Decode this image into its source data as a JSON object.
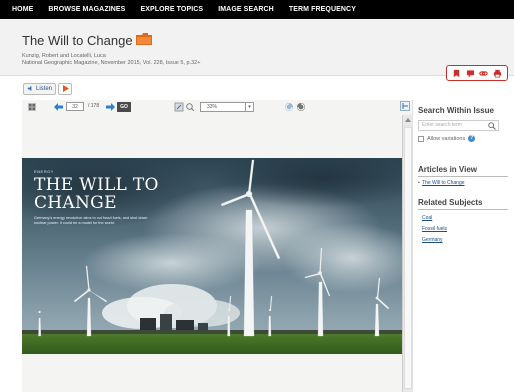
{
  "nav": {
    "items": [
      "HOME",
      "BROWSE MAGAZINES",
      "EXPLORE TOPICS",
      "IMAGE SEARCH",
      "TERM FREQUENCY"
    ]
  },
  "header": {
    "title": "The Will to Change",
    "authors": "Kunzig, Robert and Locatelli, Luca",
    "citation": "National Geographic Magazine, November 2015, Vol. 228, Issue 5, p.32+",
    "tool_icons": [
      "bookmark-icon",
      "comment-icon",
      "link-icon",
      "print-icon"
    ],
    "accent_color": "#c9302c"
  },
  "listen": {
    "label": "Listen"
  },
  "viewer": {
    "page_number": "32",
    "page_total": "/ 178",
    "go_label": "GO",
    "zoom": "33%",
    "article": {
      "kicker": "ENERGY",
      "title": "THE WILL TO CHANGE",
      "deck": "Germany's energy revolution aims to cut fossil fuels, and shut down nuclear power. It could be a model for the world."
    }
  },
  "sidebar": {
    "search_heading": "Search Within Issue",
    "search_placeholder": "Enter search term",
    "variations_label": "Allow variations",
    "help_label": "?",
    "articles_heading": "Articles in View",
    "articles": [
      "The Will to Change"
    ],
    "subjects_heading": "Related Subjects",
    "subjects": [
      "Coal",
      "Fossil fuels",
      "Germany"
    ]
  }
}
